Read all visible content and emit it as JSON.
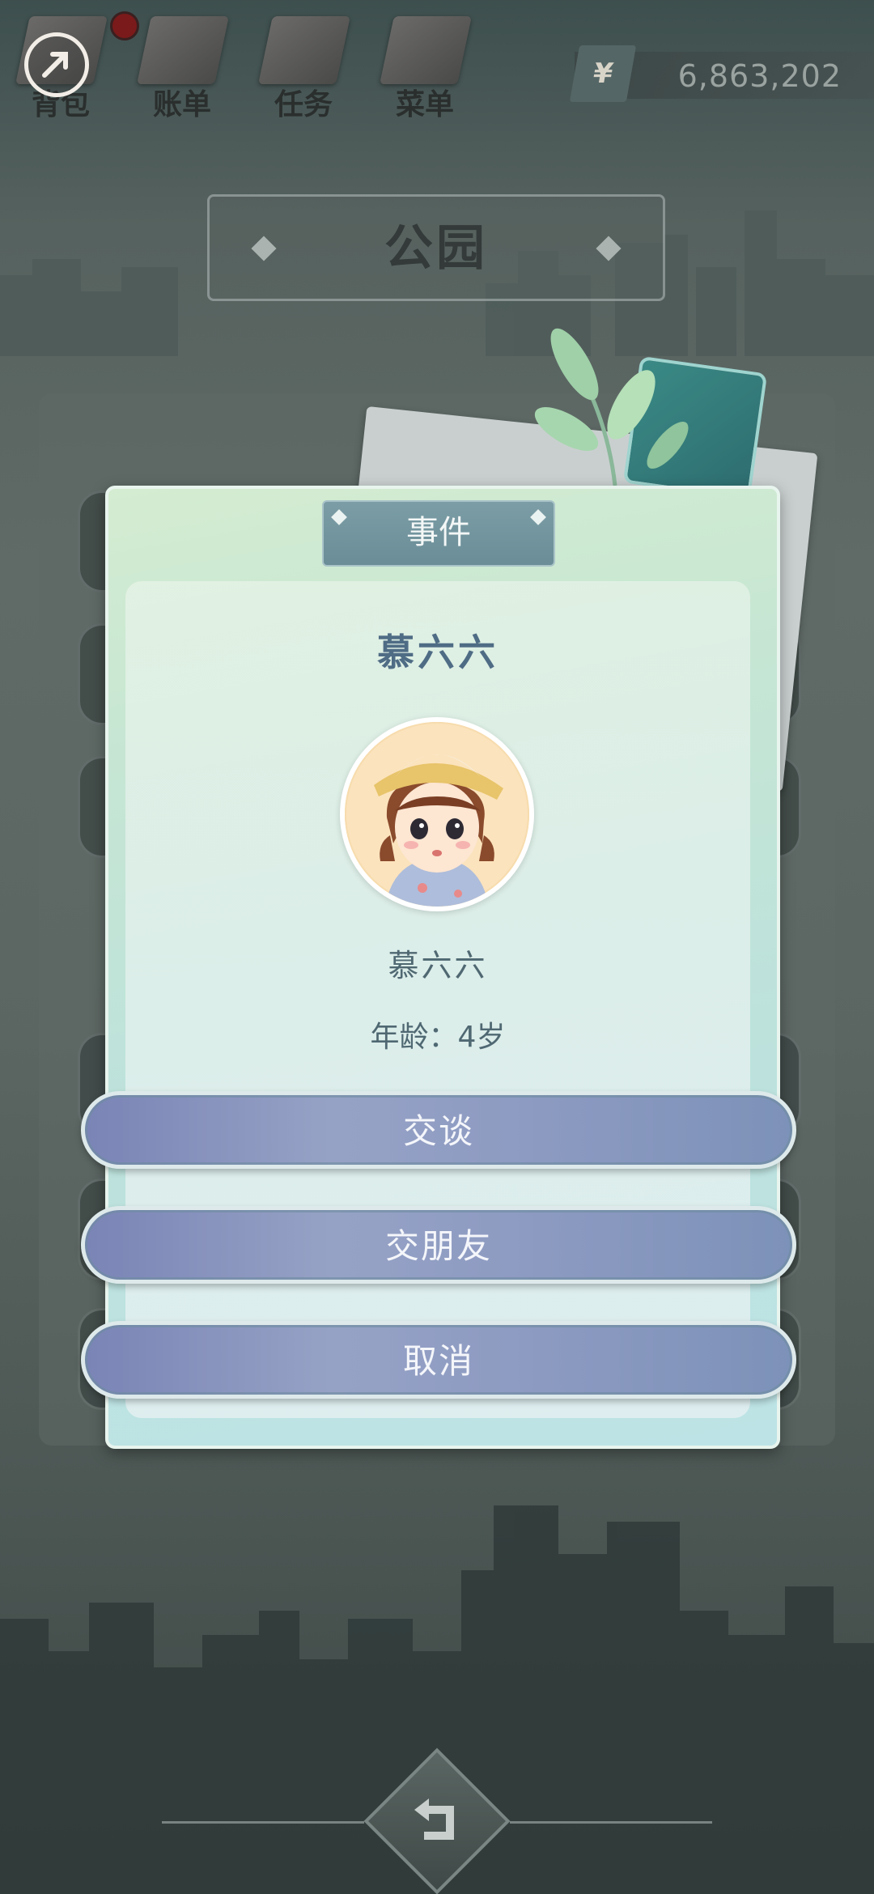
{
  "top_nav": {
    "items": [
      {
        "label": "背包"
      },
      {
        "label": "账单"
      },
      {
        "label": "任务"
      },
      {
        "label": "菜单"
      }
    ],
    "money": "6,863,202",
    "currency_symbol": "¥"
  },
  "location": {
    "name": "公园"
  },
  "dialog": {
    "header": "事件",
    "title": "慕六六",
    "character_name": "慕六六",
    "age_line": "年龄：4岁",
    "buttons": {
      "talk": "交谈",
      "befriend": "交朋友",
      "cancel": "取消"
    }
  },
  "colors": {
    "button_fill": "#8e9bc2",
    "dialog_fill": "#c6e6d3",
    "title_text": "#4f6c85"
  }
}
